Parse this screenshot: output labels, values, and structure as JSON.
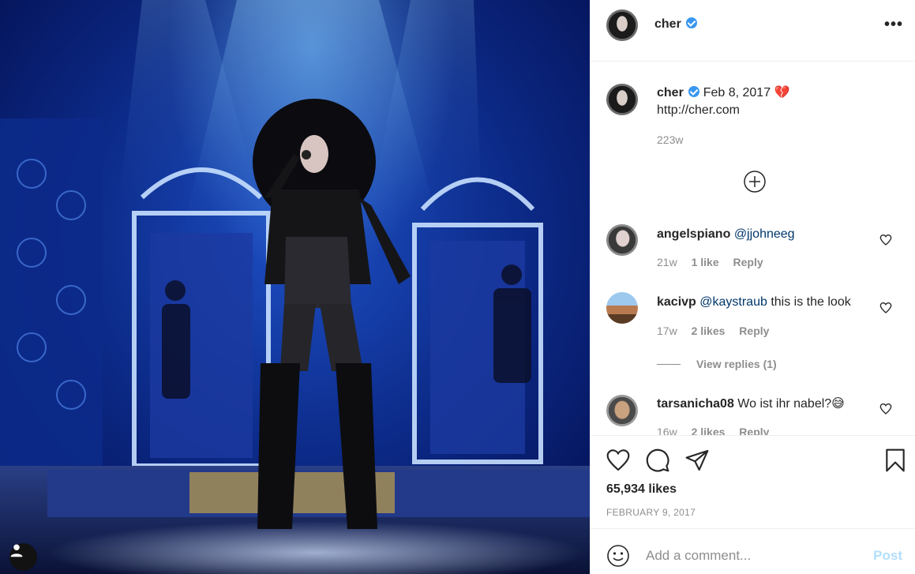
{
  "post": {
    "author": "cher",
    "verified": true,
    "photo_alt": "Cher performing on stage"
  },
  "caption": {
    "username": "cher",
    "date": "Feb 8, 2017",
    "emoji": "💔",
    "text": "http://cher.com",
    "age": "223w"
  },
  "comments": [
    {
      "username": "angelspiano",
      "mention": "@jjohneeg",
      "text": "",
      "age": "21w",
      "likes": "1 like",
      "reply": "Reply"
    },
    {
      "username": "kacivp",
      "mention": "@kaystraub",
      "text": "this is the look",
      "age": "17w",
      "likes": "2 likes",
      "reply": "Reply",
      "view_replies": "View replies (1)"
    },
    {
      "username": "tarsanicha08",
      "mention": "",
      "text": "Wo ist ihr nabel?😅",
      "age": "16w",
      "likes": "2 likes",
      "reply": "Reply"
    }
  ],
  "stats": {
    "likes": "65,934 likes",
    "date": "FEBRUARY 9, 2017"
  },
  "comment_box": {
    "placeholder": "Add a comment...",
    "post_label": "Post"
  },
  "icons": {
    "more": "more-options-icon",
    "like": "heart-icon",
    "comment": "comment-icon",
    "share": "share-icon",
    "save": "bookmark-icon",
    "emoji": "emoji-icon",
    "add": "add-circle-icon",
    "tag": "user-tag-icon"
  },
  "colors": {
    "link": "#00376b",
    "verified": "#3897f0",
    "muted": "#8e8e8e",
    "post_disabled": "#b2dffc"
  }
}
